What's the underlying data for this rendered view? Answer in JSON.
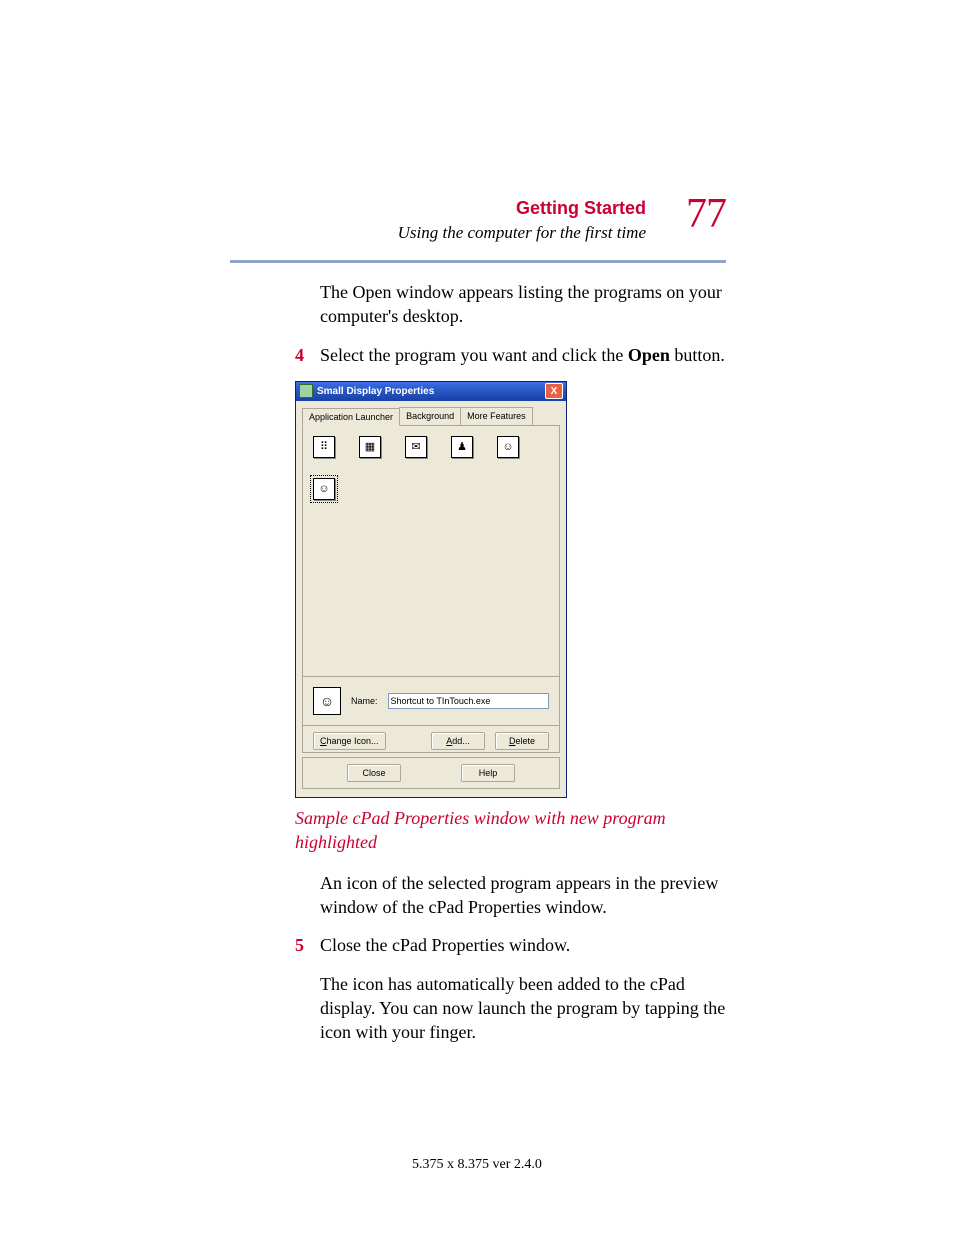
{
  "header": {
    "chapter": "Getting Started",
    "subtitle": "Using the computer for the first time",
    "page_number": "77"
  },
  "body": {
    "para1": "The Open window appears listing the programs on your computer's desktop.",
    "step4_num": "4",
    "step4_a": "Select the program you want and click the ",
    "step4_bold": "Open",
    "step4_b": " button.",
    "caption": "Sample cPad Properties window with new program highlighted",
    "para2": "An icon of the selected program appears in the preview window of the cPad Properties window.",
    "step5_num": "5",
    "step5": "Close the cPad Properties window.",
    "para3": "The icon has automatically been added to the cPad display. You can now launch the program  by tapping the icon with your finger."
  },
  "dialog": {
    "title": "Small Display Properties",
    "close_glyph": "X",
    "tabs": {
      "t1": "Application Launcher",
      "t2": "Background",
      "t3": "More Features"
    },
    "icons": {
      "i1": "⠿",
      "i2": "▦",
      "i3": "✉",
      "i4": "♟",
      "i5": "☺",
      "i6": "☺"
    },
    "name_label": "Name:",
    "name_value": "Shortcut to TInTouch.exe",
    "buttons": {
      "change_icon_u": "C",
      "change_icon_rest": "hange Icon...",
      "add_u": "A",
      "add_rest": "dd...",
      "delete_u": "D",
      "delete_rest": "elete",
      "close": "Close",
      "help": "Help"
    }
  },
  "footer": "5.375 x 8.375 ver 2.4.0"
}
